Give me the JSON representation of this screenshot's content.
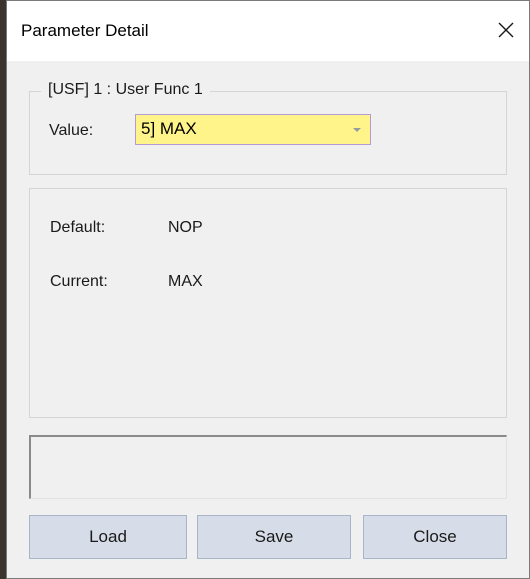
{
  "window": {
    "title": "Parameter Detail",
    "close_icon": "close-icon"
  },
  "group": {
    "legend": "[USF] 1 : User Func  1",
    "value_label": "Value:",
    "selected_value": "5] MAX",
    "dropdown_icon": "chevron-down-icon"
  },
  "info": {
    "default_label": "Default:",
    "default_value": "NOP",
    "current_label": "Current:",
    "current_value": "MAX"
  },
  "message": {
    "text": ""
  },
  "buttons": {
    "load": "Load",
    "save": "Save",
    "close": "Close"
  },
  "colors": {
    "combo_background": "#fff48a",
    "combo_border": "#b59ad8",
    "button_background": "#d6dde8",
    "button_border": "#a9b6c7",
    "dialog_background": "#f0f0f0",
    "titlebar_background": "#ffffff"
  }
}
